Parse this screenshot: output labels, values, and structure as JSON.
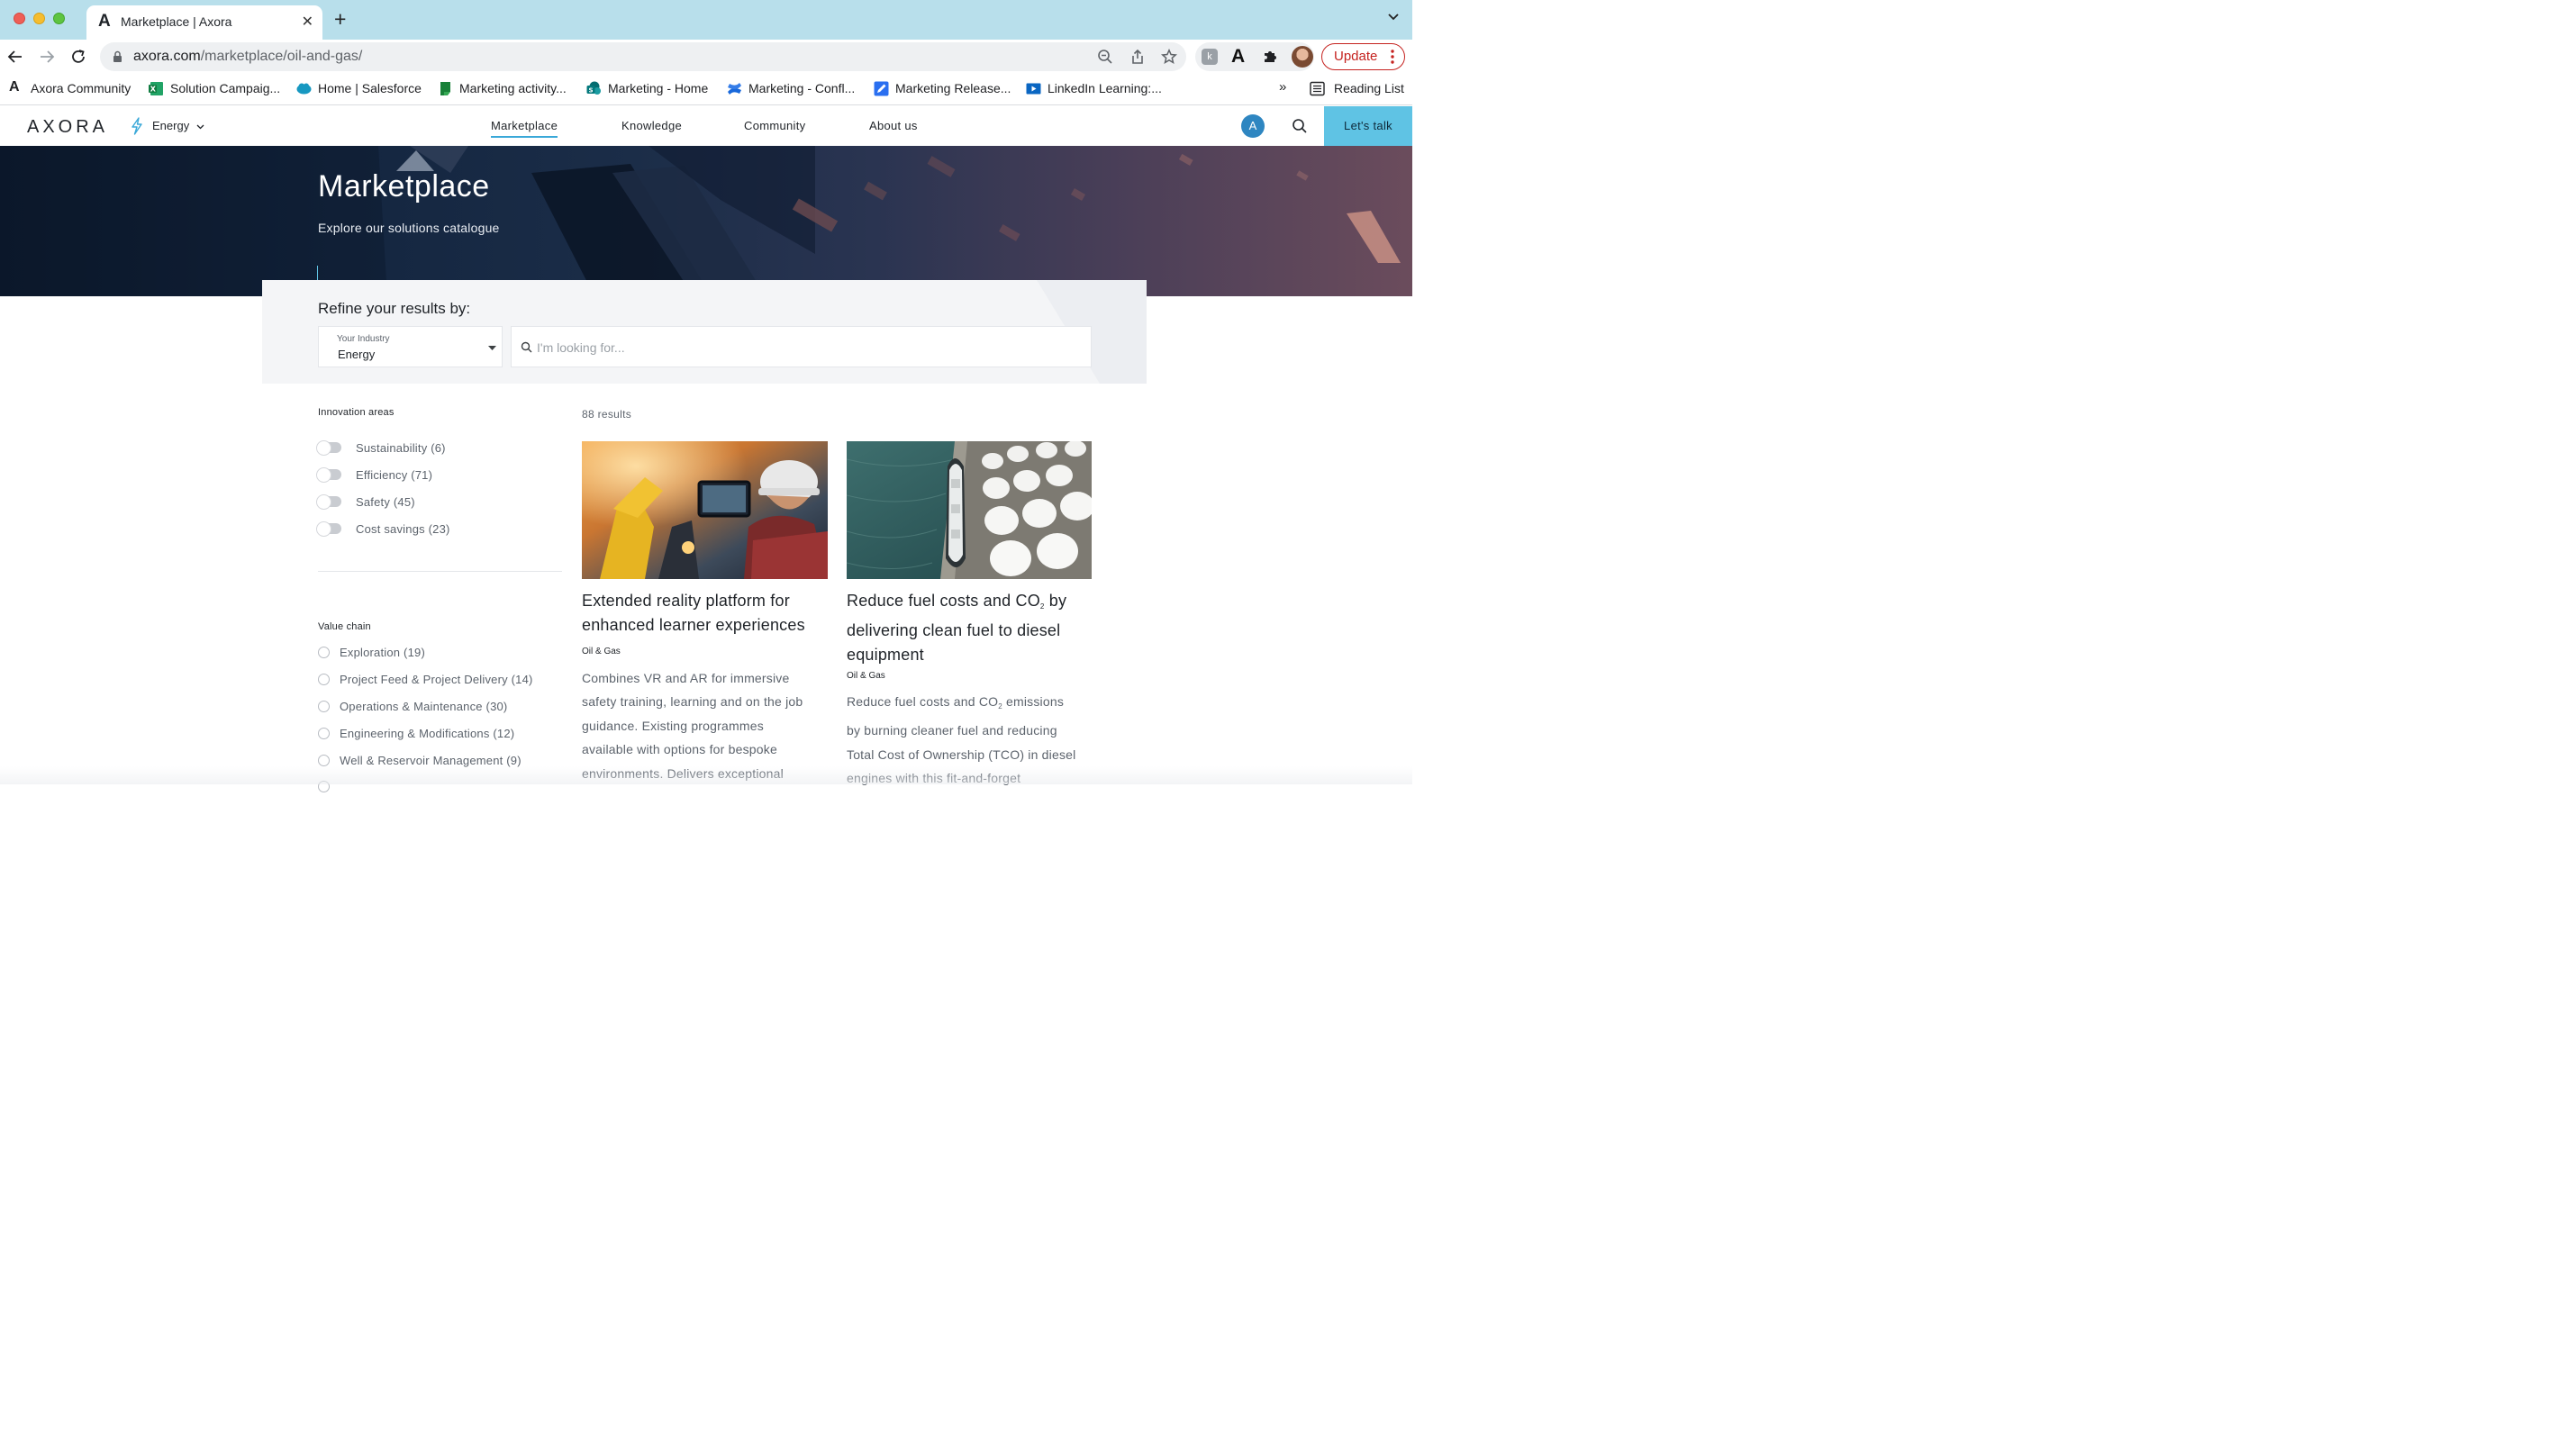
{
  "browser": {
    "tab_title": "Marketplace | Axora",
    "url_domain": "axora.com",
    "url_path": "/marketplace/oil-and-gas/",
    "update_label": "Update",
    "bookmarks": [
      {
        "label": "Axora Community",
        "icon": "axora-logo-icon"
      },
      {
        "label": "Solution Campaig...",
        "icon": "excel-icon"
      },
      {
        "label": "Home | Salesforce",
        "icon": "salesforce-cloud-icon"
      },
      {
        "label": "Marketing activity...",
        "icon": "sheets-flag-icon"
      },
      {
        "label": "Marketing - Home",
        "icon": "sharepoint-icon"
      },
      {
        "label": "Marketing - Confl...",
        "icon": "confluence-icon"
      },
      {
        "label": "Marketing Release...",
        "icon": "pencil-doc-icon"
      },
      {
        "label": "LinkedIn Learning:...",
        "icon": "video-icon"
      }
    ],
    "bookmarks_more": "»",
    "reading_list": "Reading List"
  },
  "header": {
    "brand": "AXORA",
    "industry": "Energy",
    "nav": [
      "Marketplace",
      "Knowledge",
      "Community",
      "About us"
    ],
    "avatar_initial": "A",
    "cta": "Let's talk"
  },
  "hero": {
    "title": "Marketplace",
    "subtitle": "Explore our solutions catalogue"
  },
  "refine": {
    "title": "Refine your results by:",
    "industry_label": "Your Industry",
    "industry_value": "Energy",
    "search_placeholder": "I'm looking for..."
  },
  "filters": {
    "innovation_title": "Innovation areas",
    "innovation": [
      "Sustainability (6)",
      "Efficiency (71)",
      "Safety (45)",
      "Cost savings (23)"
    ],
    "value_chain_title": "Value chain",
    "value_chain": [
      "Exploration (19)",
      "Project Feed & Project Delivery (14)",
      "Operations & Maintenance (30)",
      "Engineering & Modifications (12)",
      "Well & Reservoir Management (9)"
    ]
  },
  "results": {
    "count": "88 results",
    "cards": [
      {
        "title": "Extended reality platform for enhanced learner experiences",
        "tag": "Oil & Gas",
        "desc": [
          "Combines VR and AR for immersive",
          "safety training, learning and on the job",
          "guidance. Existing programmes",
          "available with options for bespoke",
          "environments. Delivers exceptional"
        ]
      },
      {
        "title_a": "Reduce fuel costs and CO",
        "title_sub": "2",
        "title_b": " by delivering clean fuel to diesel equipment",
        "tag": "Oil & Gas",
        "desc_a": "Reduce fuel costs and CO",
        "desc_sub": "2",
        "desc_b": " emissions",
        "desc": [
          "by burning cleaner fuel and reducing",
          "Total Cost of Ownership (TCO) in diesel",
          "engines with this fit-and-forget"
        ]
      }
    ]
  },
  "colors": {
    "accent": "#5fc3e4",
    "avatar": "#2e86c1",
    "hero_dark": "#0d1a2d",
    "update_red": "#c5221f"
  }
}
